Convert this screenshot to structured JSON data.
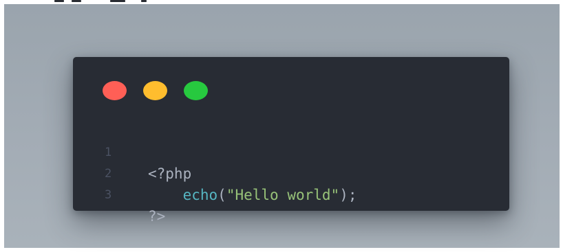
{
  "colors": {
    "background": "#a3acb5",
    "editor_bg": "#282c34",
    "dot_close": "#ff5f56",
    "dot_minimize": "#ffbd2e",
    "dot_maximize": "#27c93f",
    "line_number": "#4b5263",
    "keyword": "#56b6c2",
    "string": "#98c379",
    "punctuation": "#abb2bf"
  },
  "window_controls": [
    {
      "name": "close",
      "icon": "red-dot-icon"
    },
    {
      "name": "minimize",
      "icon": "yellow-dot-icon"
    },
    {
      "name": "maximize",
      "icon": "green-dot-icon"
    }
  ],
  "code": {
    "lines": [
      {
        "number": "1",
        "tokens": {
          "open_tag": "<?php"
        }
      },
      {
        "number": "2",
        "tokens": {
          "indent": "    ",
          "function": "echo",
          "paren_open": "(",
          "string": "\"Hello world\"",
          "paren_close": ");"
        }
      },
      {
        "number": "3",
        "tokens": {
          "close_tag": "?>"
        }
      }
    ]
  }
}
